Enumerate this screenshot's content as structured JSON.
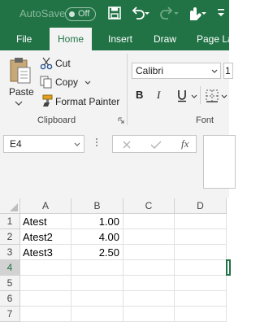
{
  "titlebar": {
    "autosave_label": "AutoSave",
    "autosave_state": "Off"
  },
  "ribbon_tabs": [
    "File",
    "Home",
    "Insert",
    "Draw",
    "Page La"
  ],
  "clipboard": {
    "paste": "Paste",
    "cut": "Cut",
    "copy": "Copy",
    "format_painter": "Format Painter",
    "group_label": "Clipboard"
  },
  "font": {
    "font_name": "Calibri",
    "font_size": "1",
    "bold": "B",
    "italic": "I",
    "group_label": "Font"
  },
  "formula_bar": {
    "name_box": "E4",
    "fx": "fx"
  },
  "sheet": {
    "columns": [
      "A",
      "B",
      "C",
      "D"
    ],
    "row_numbers": [
      "1",
      "2",
      "3",
      "4",
      "5",
      "6",
      "7"
    ],
    "cells": [
      [
        "Atest",
        "1.00",
        "",
        ""
      ],
      [
        "Atest2",
        "4.00",
        "",
        ""
      ],
      [
        "Atest3",
        "2.50",
        "",
        ""
      ],
      [
        "",
        "",
        "",
        ""
      ],
      [
        "",
        "",
        "",
        ""
      ],
      [
        "",
        "",
        "",
        ""
      ],
      [
        "",
        "",
        "",
        ""
      ]
    ],
    "active_cell": "E4"
  },
  "colors": {
    "brand": "#217346",
    "ribbon_bg": "#f3f3f3"
  }
}
